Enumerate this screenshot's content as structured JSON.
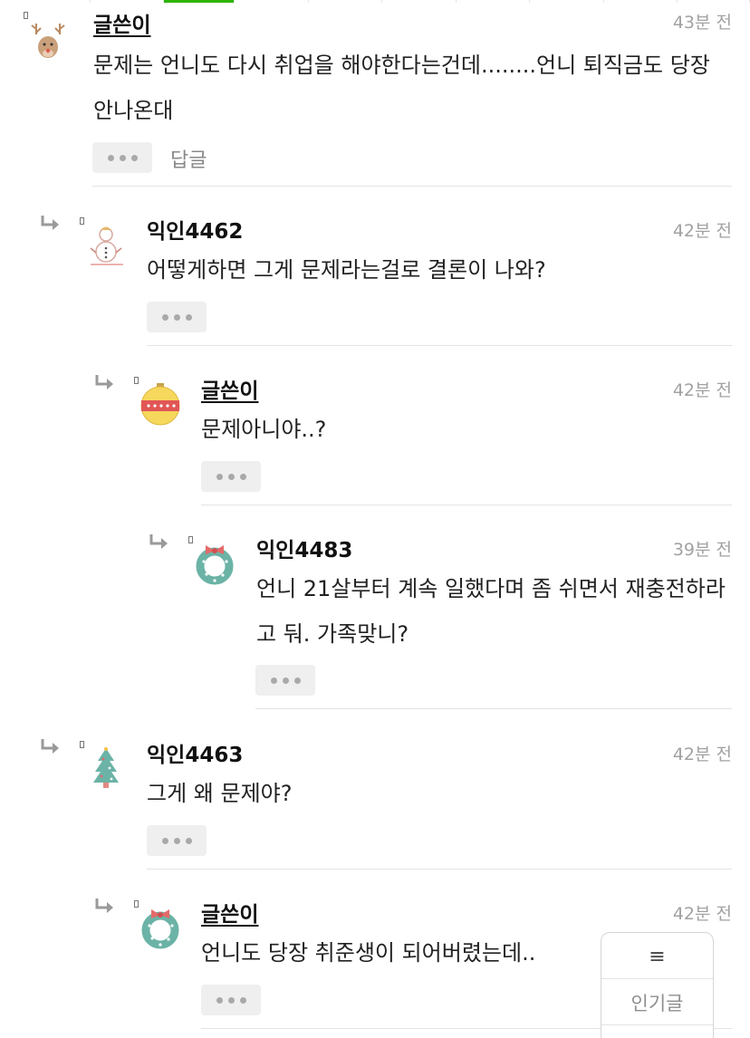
{
  "comments": [
    {
      "name": "글쓴이",
      "time": "43분 전",
      "body": "문제는 언니도 다시 취업을 해야한다는건데........언니 퇴직금도 당장 안나온대",
      "reply_label": "답글",
      "avatar": "reindeer-avatar-icon"
    },
    {
      "name": "익인4462",
      "time": "42분 전",
      "body": "어떻게하면 그게 문제라는걸로 결론이 나와?",
      "avatar": "snowman-avatar-icon"
    },
    {
      "name": "글쓴이",
      "time": "42분 전",
      "body": "문제아니야..?",
      "avatar": "ornament-avatar-icon"
    },
    {
      "name": "익인4483",
      "time": "39분 전",
      "body": "언니 21살부터 계속 일했다며 좀 쉬면서 재충전하라고 둬. 가족맞니?",
      "avatar": "wreath-avatar-icon"
    },
    {
      "name": "익인4463",
      "time": "42분 전",
      "body": "그게 왜 문제야?",
      "avatar": "christmas-tree-avatar-icon"
    },
    {
      "name": "글쓴이",
      "time": "42분 전",
      "body": "언니도 당장 취준생이 되어버렸는데..",
      "avatar": "wreath-avatar-icon"
    }
  ],
  "floating_menu": {
    "icon": "≡",
    "label": "인기글"
  },
  "colors": {
    "accent": "#2db400",
    "time": "#a2a2a2",
    "divider": "#e4e4e4"
  }
}
